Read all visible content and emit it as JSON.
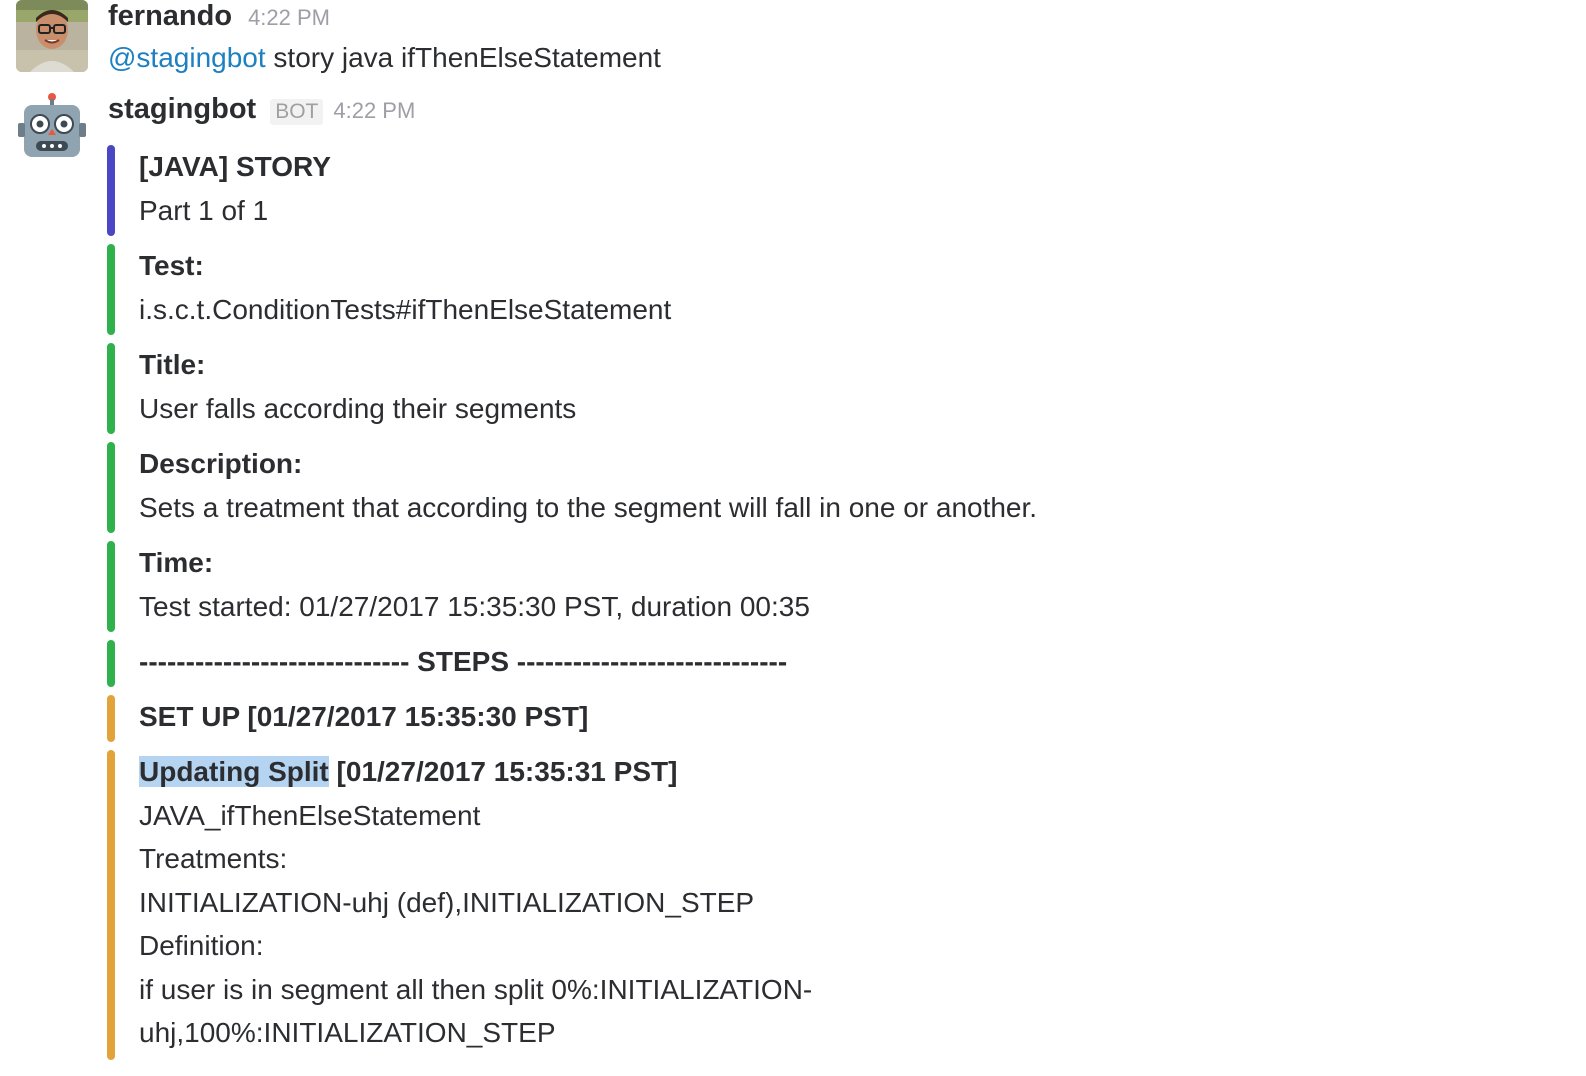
{
  "colors": {
    "story_bar": "#4b46c3",
    "field_bar": "#2fb14b",
    "step_bar": "#e2a43a",
    "mention": "#1d80c1",
    "selection": "#b4d4f2"
  },
  "messages": [
    {
      "user": "fernando",
      "time": "4:22 PM",
      "mention": "@stagingbot",
      "text": " story java ifThenElseStatement",
      "avatar_icon": "user-photo-icon"
    },
    {
      "user": "stagingbot",
      "badge": "BOT",
      "time": "4:22 PM",
      "avatar_icon": "robot-icon"
    }
  ],
  "story": {
    "title": "[JAVA] STORY",
    "part": "Part 1 of 1"
  },
  "fields": {
    "test_label": "Test:",
    "test_value": "i.s.c.t.ConditionTests#ifThenElseStatement",
    "title_label": "Title:",
    "title_value": "User falls according their segments",
    "description_label": "Description:",
    "description_value": "Sets a treatment that according to the segment will fall in one or another.",
    "time_label": "Time:",
    "time_value": "Test started: 01/27/2017 15:35:30 PST, duration 00:35",
    "steps_divider": "----------------------------- STEPS -----------------------------"
  },
  "steps": {
    "setup": "SET UP [01/27/2017 15:35:30 PST]",
    "update_name": "Updating Split",
    "update_time": " [01/27/2017 15:35:31 PST]",
    "split_name": "JAVA_ifThenElseStatement",
    "treatments_label": "Treatments:",
    "treatments_value": "INITIALIZATION-uhj (def),INITIALIZATION_STEP",
    "definition_label": "Definition:",
    "definition_line1": "if user is in segment all then split 0%:INITIALIZATION-",
    "definition_line2": "uhj,100%:INITIALIZATION_STEP"
  }
}
